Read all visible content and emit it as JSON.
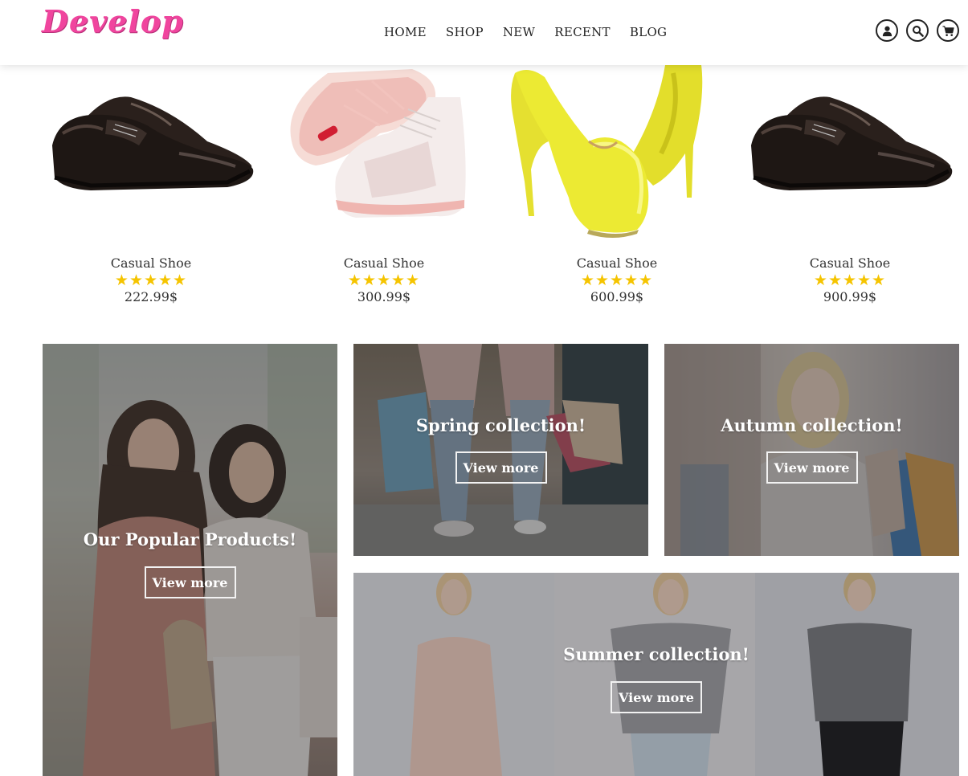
{
  "header": {
    "logo": "Develop",
    "nav": [
      "HOME",
      "SHOP",
      "NEW",
      "RECENT",
      "BLOG"
    ],
    "icons": [
      "user-icon",
      "search-icon",
      "cart-icon"
    ]
  },
  "products": [
    {
      "name": "Casual Shoe",
      "stars": "★★★★★",
      "price": "222.99$",
      "image": "black-oxford-shoe"
    },
    {
      "name": "Casual Shoe",
      "stars": "★★★★★",
      "price": "300.99$",
      "image": "white-pink-sneaker"
    },
    {
      "name": "Casual Shoe",
      "stars": "★★★★★",
      "price": "600.99$",
      "image": "yellow-high-heel"
    },
    {
      "name": "Casual Shoe",
      "stars": "★★★★★",
      "price": "900.99$",
      "image": "black-oxford-shoe"
    }
  ],
  "banners": {
    "popular": {
      "title": "Our Popular Products!",
      "button": "View more"
    },
    "spring": {
      "title": "Spring collection!",
      "button": "View more"
    },
    "autumn": {
      "title": "Autumn collection!",
      "button": "View more"
    },
    "summer": {
      "title": "Summer collection!",
      "button": "View more"
    }
  },
  "colors": {
    "brand": "#f0459e",
    "star": "#f5c400",
    "text": "#333333"
  }
}
